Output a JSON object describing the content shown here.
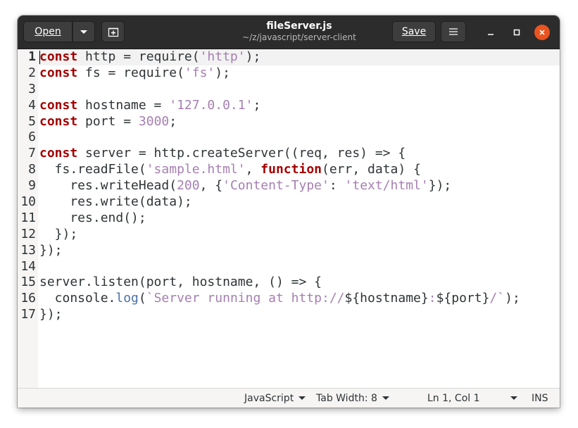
{
  "window": {
    "title": "fileServer.js",
    "subtitle": "~/z/javascript/server-client"
  },
  "header": {
    "open_label": "Open",
    "save_label": "Save"
  },
  "editor": {
    "lines": [
      {
        "n": "1",
        "segments": [
          [
            "kw",
            "const"
          ],
          [
            "t",
            " http = require("
          ],
          [
            "str",
            "'http'"
          ],
          [
            "t",
            ");"
          ]
        ]
      },
      {
        "n": "2",
        "segments": [
          [
            "kw",
            "const"
          ],
          [
            "t",
            " fs = require("
          ],
          [
            "str",
            "'fs'"
          ],
          [
            "t",
            ");"
          ]
        ]
      },
      {
        "n": "3",
        "segments": []
      },
      {
        "n": "4",
        "segments": [
          [
            "kw",
            "const"
          ],
          [
            "t",
            " hostname = "
          ],
          [
            "str",
            "'127.0.0.1'"
          ],
          [
            "t",
            ";"
          ]
        ]
      },
      {
        "n": "5",
        "segments": [
          [
            "kw",
            "const"
          ],
          [
            "t",
            " port = "
          ],
          [
            "num",
            "3000"
          ],
          [
            "t",
            ";"
          ]
        ]
      },
      {
        "n": "6",
        "segments": []
      },
      {
        "n": "7",
        "segments": [
          [
            "kw",
            "const"
          ],
          [
            "t",
            " server = http.createServer((req, res) => {"
          ]
        ]
      },
      {
        "n": "8",
        "segments": [
          [
            "t",
            "  fs.readFile("
          ],
          [
            "str",
            "'sample.html'"
          ],
          [
            "t",
            ", "
          ],
          [
            "kw",
            "function"
          ],
          [
            "t",
            "(err, data) {"
          ]
        ]
      },
      {
        "n": "9",
        "segments": [
          [
            "t",
            "    res.writeHead("
          ],
          [
            "num",
            "200"
          ],
          [
            "t",
            ", {"
          ],
          [
            "str",
            "'Content-Type'"
          ],
          [
            "t",
            ": "
          ],
          [
            "str",
            "'text/html'"
          ],
          [
            "t",
            "});"
          ]
        ]
      },
      {
        "n": "10",
        "segments": [
          [
            "t",
            "    res.write(data);"
          ]
        ]
      },
      {
        "n": "11",
        "segments": [
          [
            "t",
            "    res.end();"
          ]
        ]
      },
      {
        "n": "12",
        "segments": [
          [
            "t",
            "  });"
          ]
        ]
      },
      {
        "n": "13",
        "segments": [
          [
            "t",
            "});"
          ]
        ]
      },
      {
        "n": "14",
        "segments": []
      },
      {
        "n": "15",
        "segments": [
          [
            "t",
            "server.listen(port, hostname, () => {"
          ]
        ]
      },
      {
        "n": "16",
        "segments": [
          [
            "t",
            "  console."
          ],
          [
            "fn",
            "log"
          ],
          [
            "t",
            "("
          ],
          [
            "str",
            "`Server running at http://"
          ],
          [
            "t",
            "${hostname}"
          ],
          [
            "str",
            ":"
          ],
          [
            "t",
            "${port}"
          ],
          [
            "str",
            "/`"
          ],
          [
            "t",
            ");"
          ]
        ]
      },
      {
        "n": "17",
        "segments": [
          [
            "t",
            "});"
          ]
        ]
      }
    ],
    "current_line": "1"
  },
  "statusbar": {
    "language": "JavaScript",
    "tab_width": "Tab Width: 8",
    "position": "Ln 1, Col 1",
    "mode": "INS"
  },
  "colors": {
    "header_bg": "#2c2c2c",
    "close_button": "#e95420",
    "keyword": "#a40000",
    "string": "#a67fb2",
    "function": "#4a71a8"
  },
  "icons": [
    "chevron-down-icon",
    "new-tab-icon",
    "hamburger-menu-icon",
    "minimize-icon",
    "maximize-icon",
    "close-icon"
  ]
}
